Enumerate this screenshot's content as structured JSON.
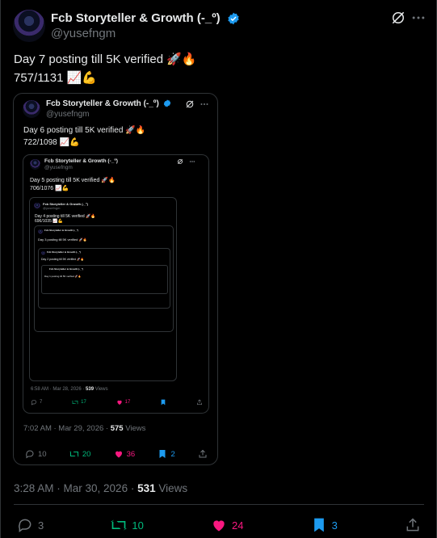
{
  "post": {
    "author_name": "Fcb Storyteller & Growth (-_º)",
    "handle": "@yusefngm",
    "line1": "Day 7 posting till 5K verified 🚀🔥",
    "line2": "757/1131 📈💪",
    "time": "3:28 AM · Mar 30, 2026 · ",
    "views": "531",
    "views_label": " Views",
    "stats": {
      "replies": "3",
      "reposts": "10",
      "likes": "24",
      "bookmarks": "3"
    }
  },
  "quote1": {
    "author_name": "Fcb Storyteller & Growth (-_º)",
    "handle": "@yusefngm",
    "line1": "Day 6 posting till 5K verified 🚀🔥",
    "line2": "722/1098 📈💪",
    "time": "7:02 AM · Mar 29, 2026 · ",
    "views": "575",
    "views_label": " Views",
    "stats": {
      "replies": "10",
      "reposts": "20",
      "likes": "36",
      "bookmarks": "2"
    }
  },
  "quote2": {
    "author_name": "Fcb Storyteller & Growth (-_º)",
    "handle": "@yusefngm",
    "line1": "Day 5 posting till 5K verified 🚀🔥",
    "line2": "706/1076 📈💪",
    "time": "6:58 AM · Mar 28, 2026 · ",
    "views": "539",
    "views_label": " Views",
    "stats": {
      "replies": "7",
      "reposts": "17",
      "likes": "17",
      "bookmarks": ""
    }
  },
  "quote3": {
    "author_name": "Fcb Storyteller & Growth (-_º)",
    "handle": "@yusefngm",
    "line1": "Day 4 posting till 5K verified 🚀🔥",
    "line2": "696/1035 📈💪"
  },
  "quote4": {
    "author_name": "Fcb Storyteller & Growth (-_º)",
    "line1": "Day 3 posting till 5K verified 🚀🔥"
  },
  "quote5": {
    "author_name": "Fcb Storyteller & Growth (-_º)",
    "line1": "Day 2 posting till 5K verified 🚀🔥"
  },
  "quote6": {
    "author_name": "Fcb Storyteller & Growth (-_º)",
    "line1": "Day 1 posting till 5K verified 🚀🔥"
  },
  "colors": {
    "repost": "#00ba7c",
    "like": "#f91880",
    "bookmark": "#1d9bf0",
    "muted": "#71767b",
    "verified": "#1d9bf0"
  },
  "icons": [
    "grok-icon",
    "more-icon",
    "reply-icon",
    "repost-icon",
    "heart-icon",
    "bookmark-icon",
    "share-icon",
    "verified-badge-icon"
  ]
}
